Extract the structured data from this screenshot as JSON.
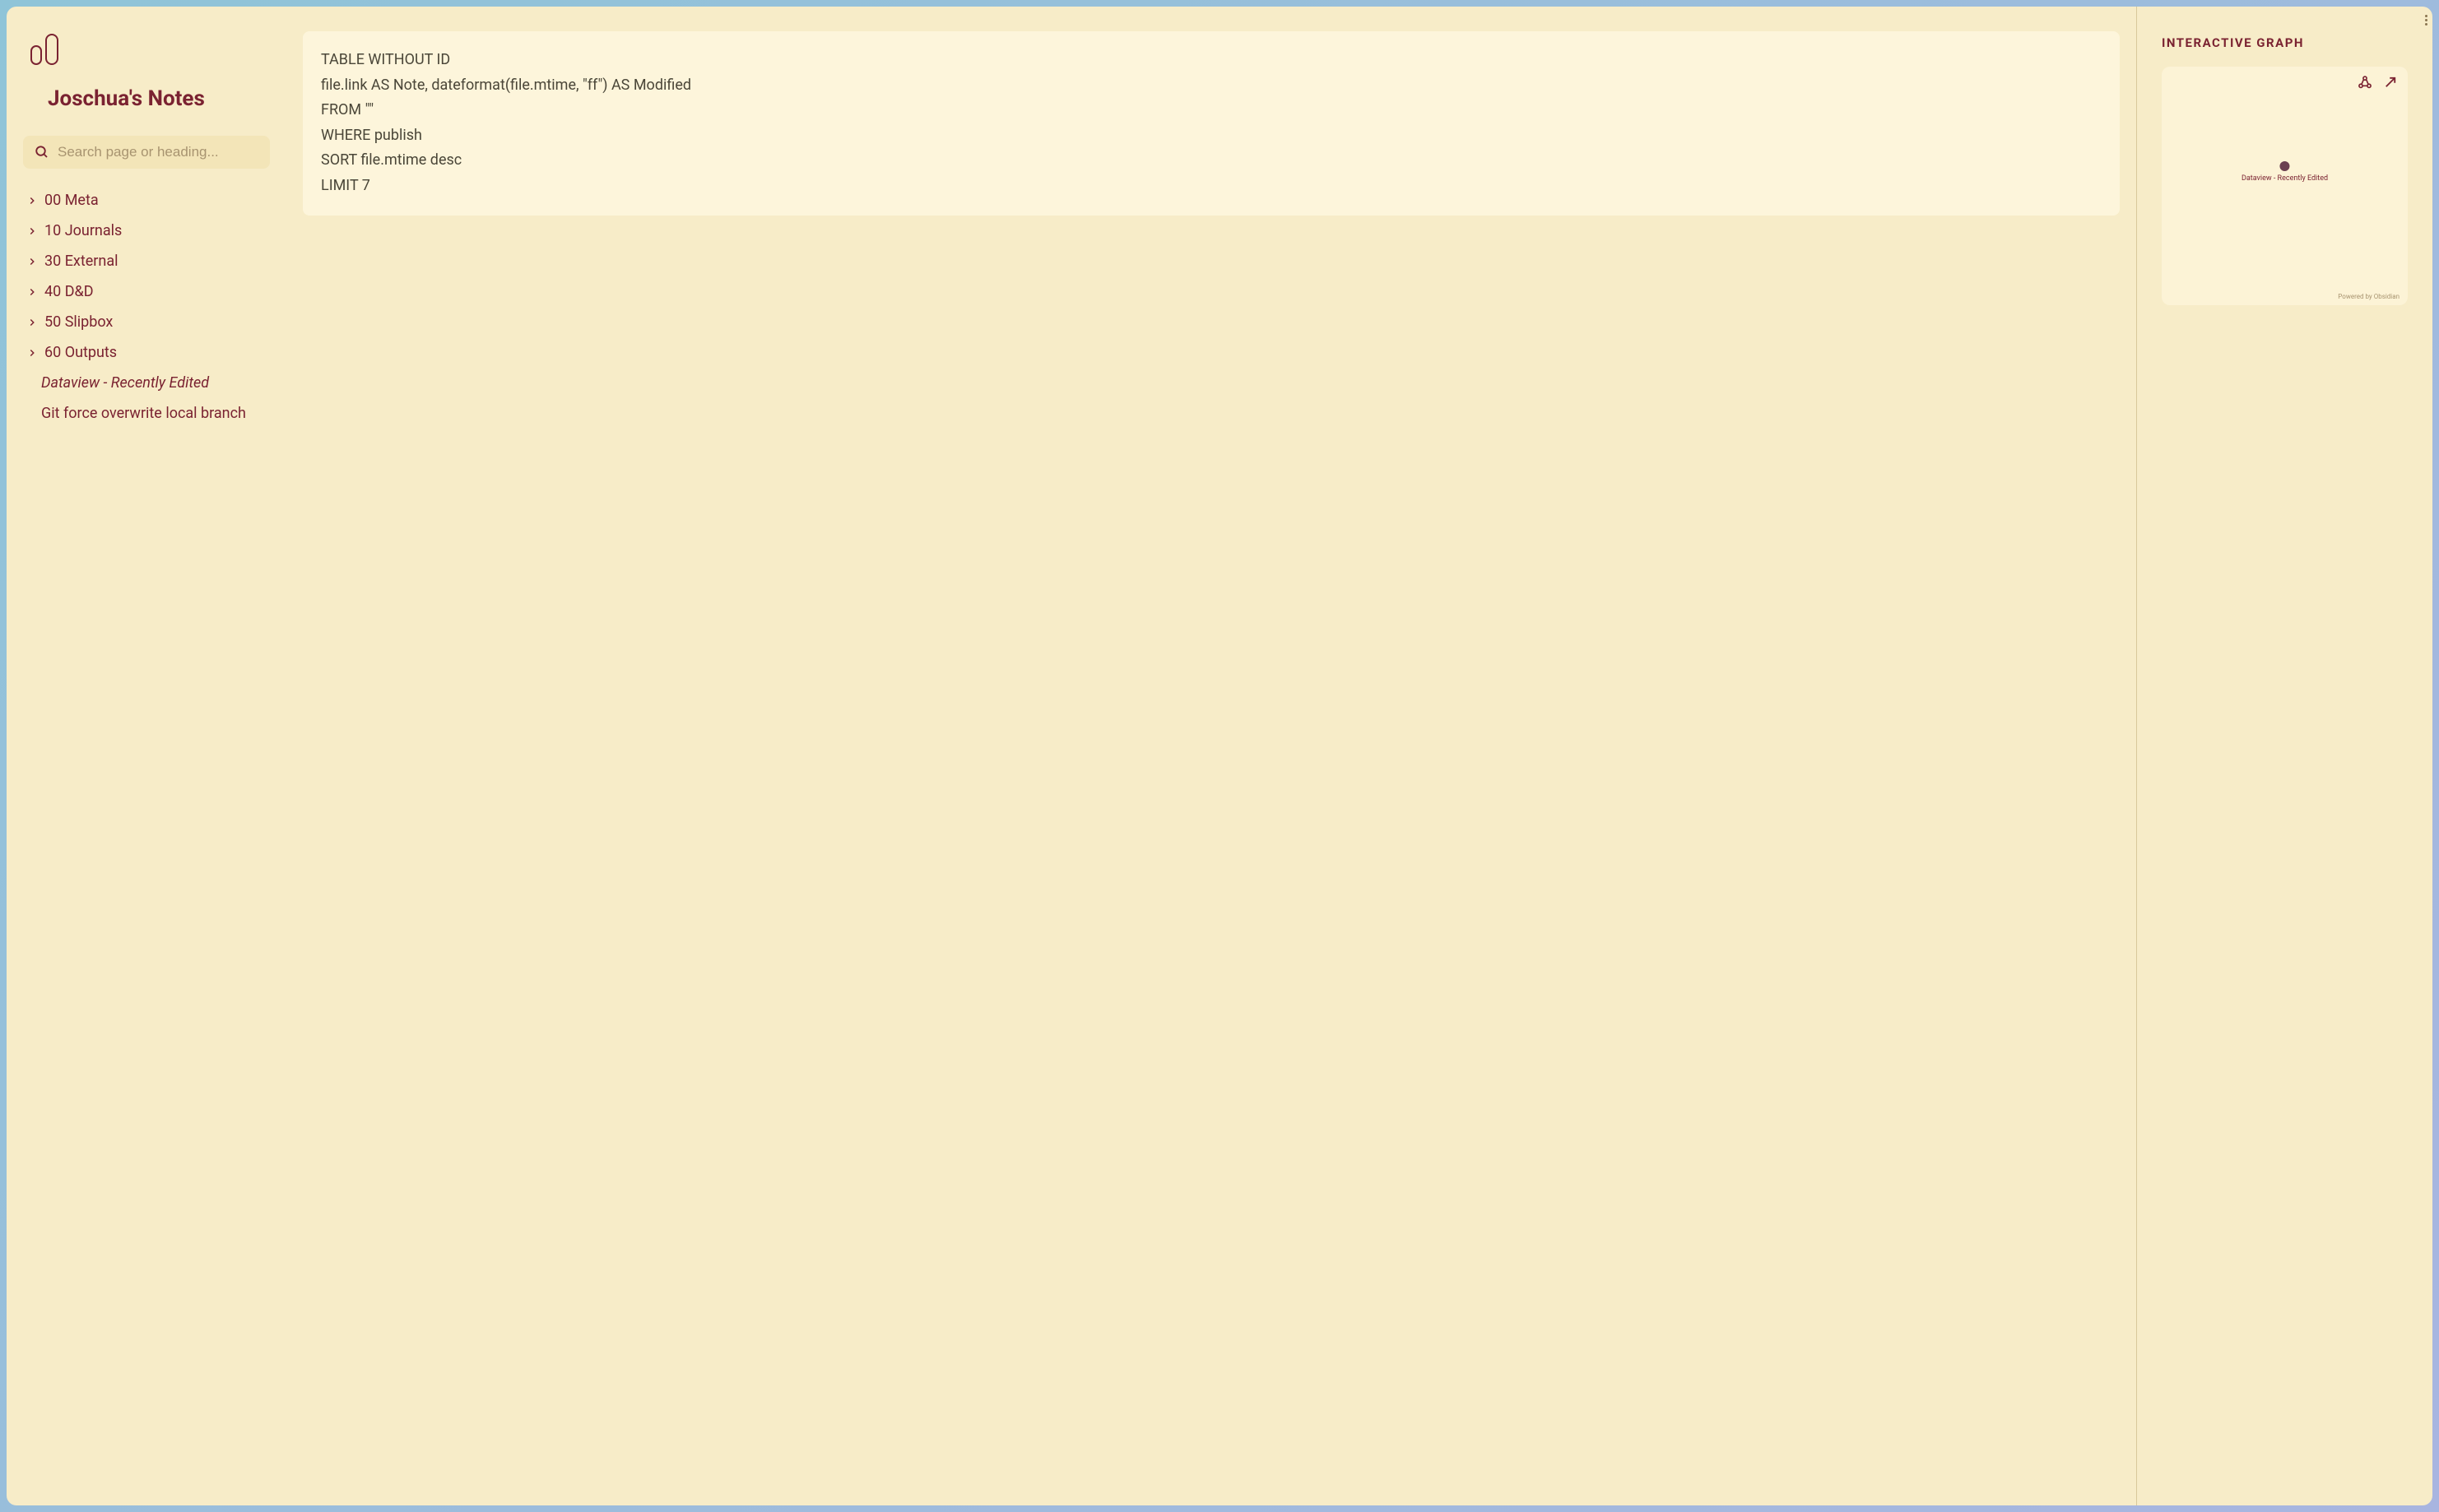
{
  "sidebar": {
    "title": "Joschua's Notes",
    "search_placeholder": "Search page or heading...",
    "nav_items": [
      {
        "label": "00 Meta",
        "has_chevron": true,
        "italic": false
      },
      {
        "label": "10 Journals",
        "has_chevron": true,
        "italic": false
      },
      {
        "label": "30 External",
        "has_chevron": true,
        "italic": false
      },
      {
        "label": "40 D&D",
        "has_chevron": true,
        "italic": false
      },
      {
        "label": "50 Slipbox",
        "has_chevron": true,
        "italic": false
      },
      {
        "label": "60 Outputs",
        "has_chevron": true,
        "italic": false
      },
      {
        "label": "Dataview - Recently Edited",
        "has_chevron": false,
        "italic": true
      },
      {
        "label": "Git force overwrite local branch",
        "has_chevron": false,
        "italic": false
      }
    ]
  },
  "main": {
    "code_lines": [
      "TABLE WITHOUT ID",
      "file.link AS Note, dateformat(file.mtime, \"ff\") AS Modified",
      "FROM \"\"",
      "WHERE publish",
      "SORT file.mtime desc",
      "LIMIT 7"
    ]
  },
  "right_panel": {
    "title": "INTERACTIVE GRAPH",
    "node_label": "Dataview - Recently Edited",
    "footer": "Powered by Obsidian"
  },
  "colors": {
    "accent": "#7a2231",
    "bg": "#f7ecc8",
    "code_bg": "#fdf5db"
  }
}
